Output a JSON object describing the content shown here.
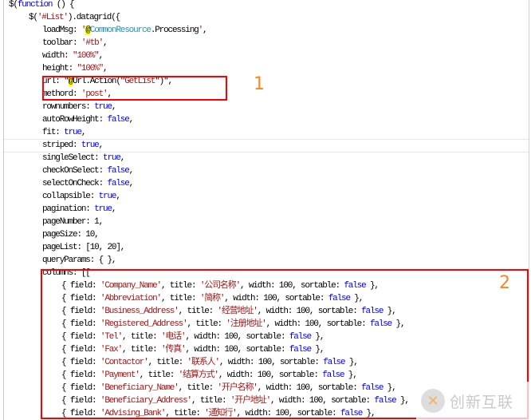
{
  "code": {
    "lines": [
      {
        "indent": 0,
        "tokens": [
          [
            "$(",
            "p"
          ],
          [
            "function",
            "kw"
          ],
          [
            " () {",
            "p"
          ]
        ]
      },
      {
        "indent": 1,
        "tokens": [
          [
            "$(",
            "p"
          ],
          [
            "'#List'",
            "str"
          ],
          [
            ").datagrid({",
            "p"
          ]
        ]
      },
      {
        "indent": 2,
        "tokens": [
          [
            "loadMsg: ",
            "p"
          ],
          [
            "'",
            "str"
          ],
          [
            "@",
            "at"
          ],
          [
            "CommonResource",
            "cls"
          ],
          [
            ".Processing",
            "p"
          ],
          [
            "'",
            "str"
          ],
          [
            ",",
            "p"
          ]
        ]
      },
      {
        "indent": 2,
        "tokens": [
          [
            "toolbar: ",
            "p"
          ],
          [
            "'#tb'",
            "str"
          ],
          [
            ",",
            "p"
          ]
        ]
      },
      {
        "indent": 2,
        "tokens": [
          [
            "width: ",
            "p"
          ],
          [
            "\"100%\"",
            "str"
          ],
          [
            ",",
            "p"
          ]
        ]
      },
      {
        "indent": 2,
        "tokens": [
          [
            "height: ",
            "p"
          ],
          [
            "\"100%\"",
            "str"
          ],
          [
            ",",
            "p"
          ]
        ]
      },
      {
        "indent": 2,
        "tokens": [
          [
            "url: \"",
            "p"
          ],
          [
            "@",
            "at"
          ],
          [
            "Url.Action(\"",
            "p"
          ],
          [
            "GetList",
            "str"
          ],
          [
            "\")\",",
            "p"
          ]
        ]
      },
      {
        "indent": 2,
        "tokens": [
          [
            "methord: ",
            "p"
          ],
          [
            "'post'",
            "str"
          ],
          [
            ",",
            "p"
          ]
        ]
      },
      {
        "indent": 2,
        "tokens": [
          [
            "rownumbers: ",
            "p"
          ],
          [
            "true",
            "kw"
          ],
          [
            ",",
            "p"
          ]
        ]
      },
      {
        "indent": 2,
        "tokens": [
          [
            "autoRowHeight: ",
            "p"
          ],
          [
            "false",
            "kw"
          ],
          [
            ",",
            "p"
          ]
        ]
      },
      {
        "indent": 2,
        "tokens": [
          [
            "fit: ",
            "p"
          ],
          [
            "true",
            "kw"
          ],
          [
            ",",
            "p"
          ]
        ]
      },
      {
        "indent": 2,
        "tokens": [
          [
            "striped: ",
            "p"
          ],
          [
            "true",
            "kw"
          ],
          [
            ",",
            "p"
          ]
        ]
      },
      {
        "indent": 2,
        "tokens": [
          [
            "singleSelect: ",
            "p"
          ],
          [
            "true",
            "kw"
          ],
          [
            ",",
            "p"
          ]
        ]
      },
      {
        "indent": 2,
        "tokens": [
          [
            "checkOnSelect: ",
            "p"
          ],
          [
            "false",
            "kw"
          ],
          [
            ",",
            "p"
          ]
        ]
      },
      {
        "indent": 2,
        "tokens": [
          [
            "selectOnCheck: ",
            "p"
          ],
          [
            "false",
            "kw"
          ],
          [
            ",",
            "p"
          ]
        ]
      },
      {
        "indent": 2,
        "tokens": [
          [
            "collapsible: ",
            "p"
          ],
          [
            "true",
            "kw"
          ],
          [
            ",",
            "p"
          ]
        ]
      },
      {
        "indent": 2,
        "tokens": [
          [
            "pagination: ",
            "p"
          ],
          [
            "true",
            "kw"
          ],
          [
            ",",
            "p"
          ]
        ]
      },
      {
        "indent": 2,
        "tokens": [
          [
            "pageNumber: 1,",
            "p"
          ]
        ]
      },
      {
        "indent": 2,
        "tokens": [
          [
            "pageSize: 10,",
            "p"
          ]
        ]
      },
      {
        "indent": 2,
        "tokens": [
          [
            "pageList: [10, 20],",
            "p"
          ]
        ]
      },
      {
        "indent": 2,
        "tokens": [
          [
            "queryParams: { },",
            "p"
          ]
        ]
      },
      {
        "indent": 2,
        "tokens": [
          [
            "columns: [[",
            "p"
          ]
        ]
      },
      {
        "indent": 3,
        "tokens": [
          [
            "{ field: ",
            "p"
          ],
          [
            "'Company_Name'",
            "str"
          ],
          [
            ", title: ",
            "p"
          ],
          [
            "'公司名称'",
            "str"
          ],
          [
            ", width: 100, sortable: ",
            "p"
          ],
          [
            "false",
            "kw"
          ],
          [
            " },",
            "p"
          ]
        ]
      },
      {
        "indent": 3,
        "tokens": [
          [
            "{ field: ",
            "p"
          ],
          [
            "'Abbreviation'",
            "str"
          ],
          [
            ", title: ",
            "p"
          ],
          [
            "'简称'",
            "str"
          ],
          [
            ", width: 100, sortable: ",
            "p"
          ],
          [
            "false",
            "kw"
          ],
          [
            " },",
            "p"
          ]
        ]
      },
      {
        "indent": 3,
        "tokens": [
          [
            "{ field: ",
            "p"
          ],
          [
            "'Business_Address'",
            "str"
          ],
          [
            ", title: ",
            "p"
          ],
          [
            "'经营地址'",
            "str"
          ],
          [
            ", width: 100, sortable: ",
            "p"
          ],
          [
            "false",
            "kw"
          ],
          [
            " },",
            "p"
          ]
        ]
      },
      {
        "indent": 3,
        "tokens": [
          [
            "{ field: ",
            "p"
          ],
          [
            "'Registered_Address'",
            "str"
          ],
          [
            ", title: ",
            "p"
          ],
          [
            "'注册地址'",
            "str"
          ],
          [
            ", width: 100, sortable: ",
            "p"
          ],
          [
            "false",
            "kw"
          ],
          [
            " },",
            "p"
          ]
        ]
      },
      {
        "indent": 3,
        "tokens": [
          [
            "{ field: ",
            "p"
          ],
          [
            "'Tel'",
            "str"
          ],
          [
            ", title: ",
            "p"
          ],
          [
            "'电话'",
            "str"
          ],
          [
            ", width: 100, sortable: ",
            "p"
          ],
          [
            "false",
            "kw"
          ],
          [
            " },",
            "p"
          ]
        ]
      },
      {
        "indent": 3,
        "tokens": [
          [
            "{ field: ",
            "p"
          ],
          [
            "'Fax'",
            "str"
          ],
          [
            ", title: ",
            "p"
          ],
          [
            "'传真'",
            "str"
          ],
          [
            ", width: 100, sortable: ",
            "p"
          ],
          [
            "false",
            "kw"
          ],
          [
            " },",
            "p"
          ]
        ]
      },
      {
        "indent": 3,
        "tokens": [
          [
            "{ field: ",
            "p"
          ],
          [
            "'Contactor'",
            "str"
          ],
          [
            ", title: ",
            "p"
          ],
          [
            "'联系人'",
            "str"
          ],
          [
            ", width: 100, sortable: ",
            "p"
          ],
          [
            "false",
            "kw"
          ],
          [
            " },",
            "p"
          ]
        ]
      },
      {
        "indent": 3,
        "tokens": [
          [
            "{ field: ",
            "p"
          ],
          [
            "'Payment'",
            "str"
          ],
          [
            ", title: ",
            "p"
          ],
          [
            "'结算方式'",
            "str"
          ],
          [
            ", width: 100, sortable: ",
            "p"
          ],
          [
            "false",
            "kw"
          ],
          [
            " },",
            "p"
          ]
        ]
      },
      {
        "indent": 3,
        "tokens": [
          [
            "{ field: ",
            "p"
          ],
          [
            "'Beneficiary_Name'",
            "str"
          ],
          [
            ", title: ",
            "p"
          ],
          [
            "'开户名称'",
            "str"
          ],
          [
            ", width: 100, sortable: ",
            "p"
          ],
          [
            "false",
            "kw"
          ],
          [
            " },",
            "p"
          ]
        ]
      },
      {
        "indent": 3,
        "tokens": [
          [
            "{ field: ",
            "p"
          ],
          [
            "'Beneficiary_Address'",
            "str"
          ],
          [
            ", title: ",
            "p"
          ],
          [
            "'开户地址'",
            "str"
          ],
          [
            ", width: 100, sortable: ",
            "p"
          ],
          [
            "false",
            "kw"
          ],
          [
            " },",
            "p"
          ]
        ]
      },
      {
        "indent": 3,
        "tokens": [
          [
            "{ field: ",
            "p"
          ],
          [
            "'Advising_Bank'",
            "str"
          ],
          [
            ", title: ",
            "p"
          ],
          [
            "'通知行'",
            "str"
          ],
          [
            ", width: 100, sortable: ",
            "p"
          ],
          [
            "false",
            "kw"
          ],
          [
            " },",
            "p"
          ]
        ]
      }
    ]
  },
  "annotations": {
    "marker_1": "1",
    "marker_2": "2",
    "box_color": "#ff0000",
    "marker_color": "#f08a24"
  },
  "watermark": {
    "text": "创新互联"
  }
}
